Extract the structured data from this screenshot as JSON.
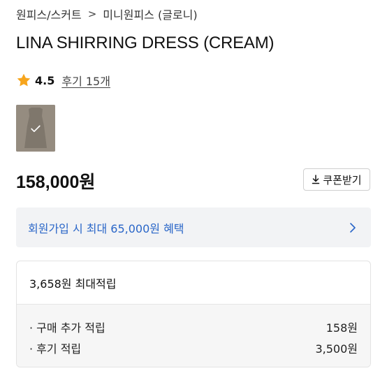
{
  "breadcrumb": {
    "category": "원피스/스커트",
    "separator": ">",
    "subcategory": "미니원피스 (글로니)"
  },
  "product": {
    "title": "LINA SHIRRING DRESS (CREAM)",
    "rating": "4.5",
    "review_link": "후기 15개",
    "price": "158,000원",
    "thumbnail_selected": true
  },
  "coupon_button": {
    "label": "쿠폰받기",
    "icon": "download-icon"
  },
  "signup_banner": {
    "text": "회원가입 시 최대 65,000원 혜택",
    "icon": "chevron-right-icon"
  },
  "points": {
    "header": "3,658원 최대적립",
    "rows": [
      {
        "label": "· 구매 추가 적립",
        "value": "158원"
      },
      {
        "label": "· 후기 적립",
        "value": "3,500원"
      }
    ]
  },
  "colors": {
    "star": "#f7a51c",
    "link_blue": "#2a66c8",
    "banner_bg": "#f2f3f5",
    "thumbnail_bg": "#938a7e"
  }
}
